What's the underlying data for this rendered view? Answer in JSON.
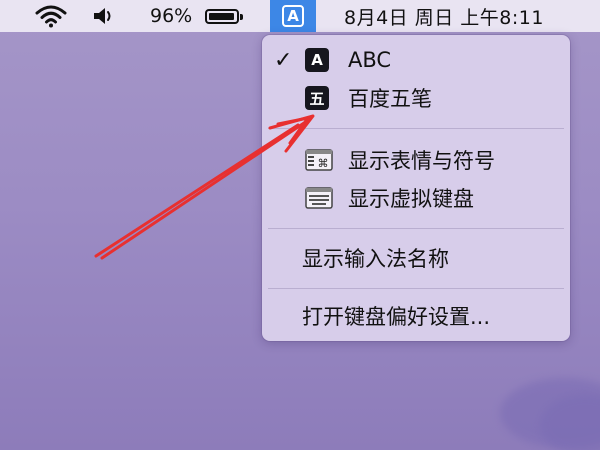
{
  "menubar": {
    "wifi_icon": "wifi-icon",
    "volume_icon": "volume-icon",
    "battery_percent": "96%",
    "battery_level": 0.96,
    "input_source_letter": "A",
    "datetime": "8月4日 周日 上午8:11"
  },
  "input_menu": {
    "sources": [
      {
        "badge": "A",
        "label": "ABC",
        "selected": true
      },
      {
        "badge": "五",
        "label": "百度五笔",
        "selected": false
      }
    ],
    "check_mark": "✓",
    "tools": [
      {
        "icon": "emoji-viewer-icon",
        "label": "显示表情与符号"
      },
      {
        "icon": "keyboard-viewer-icon",
        "label": "显示虚拟键盘"
      }
    ],
    "show_input_name": "显示输入法名称",
    "open_keyboard_prefs": "打开键盘偏好设置..."
  },
  "annotation": {
    "arrow_color": "#e83030"
  },
  "colors": {
    "menubar_bg": "#e9e4f2",
    "menu_bg": "#d7cdea",
    "accent": "#3d87e6",
    "desktop": "#9c8cc4"
  }
}
